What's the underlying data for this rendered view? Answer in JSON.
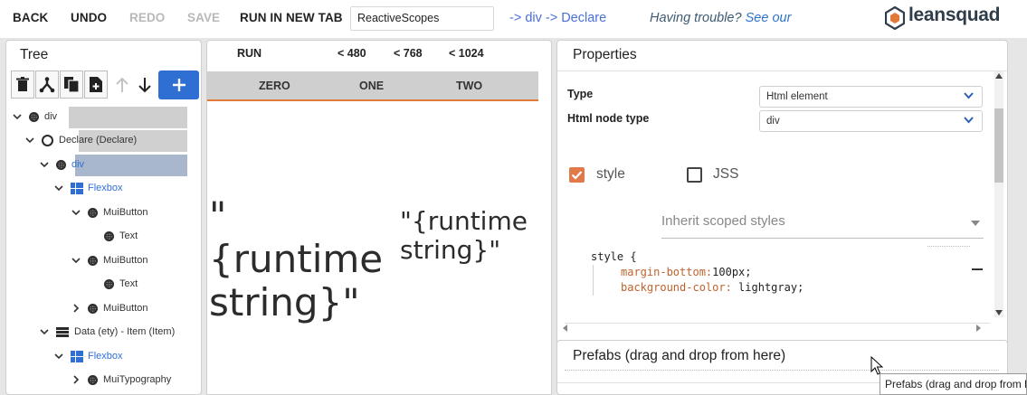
{
  "toolbar": {
    "back": "BACK",
    "undo": "UNDO",
    "redo": "REDO",
    "save": "SAVE",
    "run_new_tab": "RUN IN NEW TAB",
    "scope_value": "ReactiveScopes",
    "breadcrumb": "-> div -> Declare",
    "trouble_text": "Having trouble?",
    "trouble_link": "See our"
  },
  "logo": {
    "text": "leansquad",
    "icon": "cube-logo-icon"
  },
  "tree": {
    "title": "Tree",
    "tools": [
      "trash-icon",
      "fork-icon",
      "copy-icon",
      "paste-icon",
      "arrow-up-icon",
      "arrow-down-icon"
    ],
    "add_icon": "plus-icon",
    "nodes": [
      {
        "label": "div",
        "icon": "element-icon",
        "expanded": true
      },
      {
        "label": "Declare (Declare)",
        "icon": "ring-icon",
        "expanded": true
      },
      {
        "label": "div",
        "icon": "element-icon",
        "expanded": true
      },
      {
        "label": "Flexbox",
        "icon": "flexbox-icon",
        "expanded": true
      },
      {
        "label": "MuiButton",
        "icon": "element-icon",
        "expanded": true
      },
      {
        "label": "Text",
        "icon": "element-icon"
      },
      {
        "label": "MuiButton",
        "icon": "element-icon",
        "expanded": true
      },
      {
        "label": "Text",
        "icon": "element-icon"
      },
      {
        "label": "MuiButton",
        "icon": "element-icon",
        "expanded": false
      },
      {
        "label": "Data (ety) - Item (Item)",
        "icon": "data-icon",
        "expanded": true
      },
      {
        "label": "Flexbox",
        "icon": "flexbox-icon",
        "expanded": true
      },
      {
        "label": "MuiTypography",
        "icon": "element-icon",
        "expanded": false
      }
    ]
  },
  "preview": {
    "breakpoints": [
      "RUN",
      "< 480",
      "< 768",
      "< 1024"
    ],
    "tabs": [
      "ZERO",
      "ONE",
      "TWO"
    ],
    "runtime_large": "\"{runtime string}\"",
    "runtime_small": "\"{runtime string}\""
  },
  "properties": {
    "title": "Properties",
    "type_label": "Type",
    "type_value": "Html element",
    "node_type_label": "Html node type",
    "node_type_value": "div",
    "style_label": "style",
    "style_checked": true,
    "jss_label": "JSS",
    "jss_checked": false,
    "inherit_placeholder": "Inherit scoped styles",
    "code": {
      "selector": "style {",
      "lines": [
        {
          "name": "margin-bottom:",
          "value": "100px;"
        },
        {
          "name": "background-color:",
          "value": " lightgray;"
        }
      ]
    }
  },
  "prefabs": {
    "title": "Prefabs (drag and drop from here)",
    "tooltip": "Prefabs (drag and drop from here)"
  },
  "colors": {
    "accent_blue": "#2f6fd4",
    "tab_underline": "#e07a3a",
    "checkbox_on": "#e07a4a",
    "css_property": "#c0622d"
  }
}
